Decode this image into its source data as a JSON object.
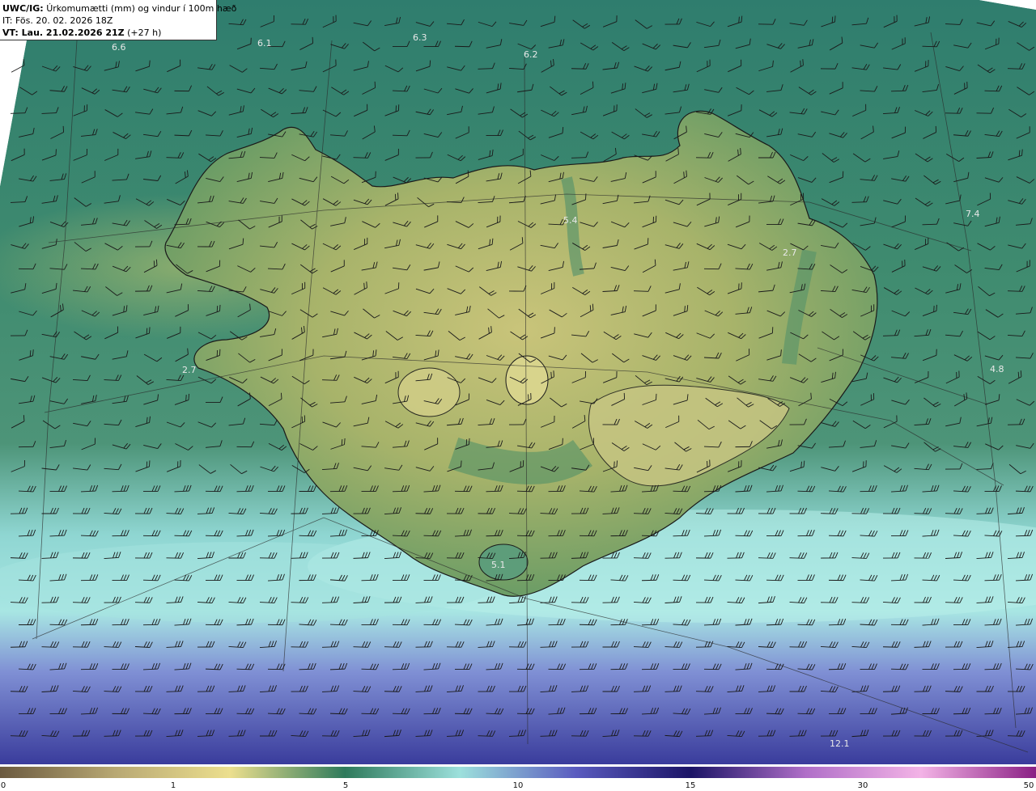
{
  "header": {
    "model": "UWC/IG:",
    "title": "Úrkomumætti (mm) og vindur í 100m hæð",
    "it_line": "IT: Fös. 20. 02. 2026 18Z",
    "vt_bold": "VT: Lau. 21.02.2026 21Z",
    "vt_suffix": "(+27 h)"
  },
  "map_labels": [
    {
      "id": "v1",
      "text": "6.6"
    },
    {
      "id": "v2",
      "text": "6.1"
    },
    {
      "id": "v3",
      "text": "6.3"
    },
    {
      "id": "v4",
      "text": "6.2"
    },
    {
      "id": "v5",
      "text": "5.4"
    },
    {
      "id": "v6",
      "text": "7.4"
    },
    {
      "id": "v7",
      "text": "2.7"
    },
    {
      "id": "v8",
      "text": "4.8"
    },
    {
      "id": "v9",
      "text": "2.7"
    },
    {
      "id": "v10",
      "text": "5.1"
    },
    {
      "id": "v11",
      "text": "12.1"
    }
  ],
  "colorbar": {
    "ticks": [
      "0",
      "1",
      "5",
      "10",
      "15",
      "30",
      "50"
    ],
    "colors": [
      "#6b5a40",
      "#b8a873",
      "#ecdf8e",
      "#2e7a5b",
      "#9ce0dc",
      "#5a5bbf",
      "#1b1466",
      "#b06fc8",
      "#f3b3e6",
      "#8a1f84"
    ]
  }
}
